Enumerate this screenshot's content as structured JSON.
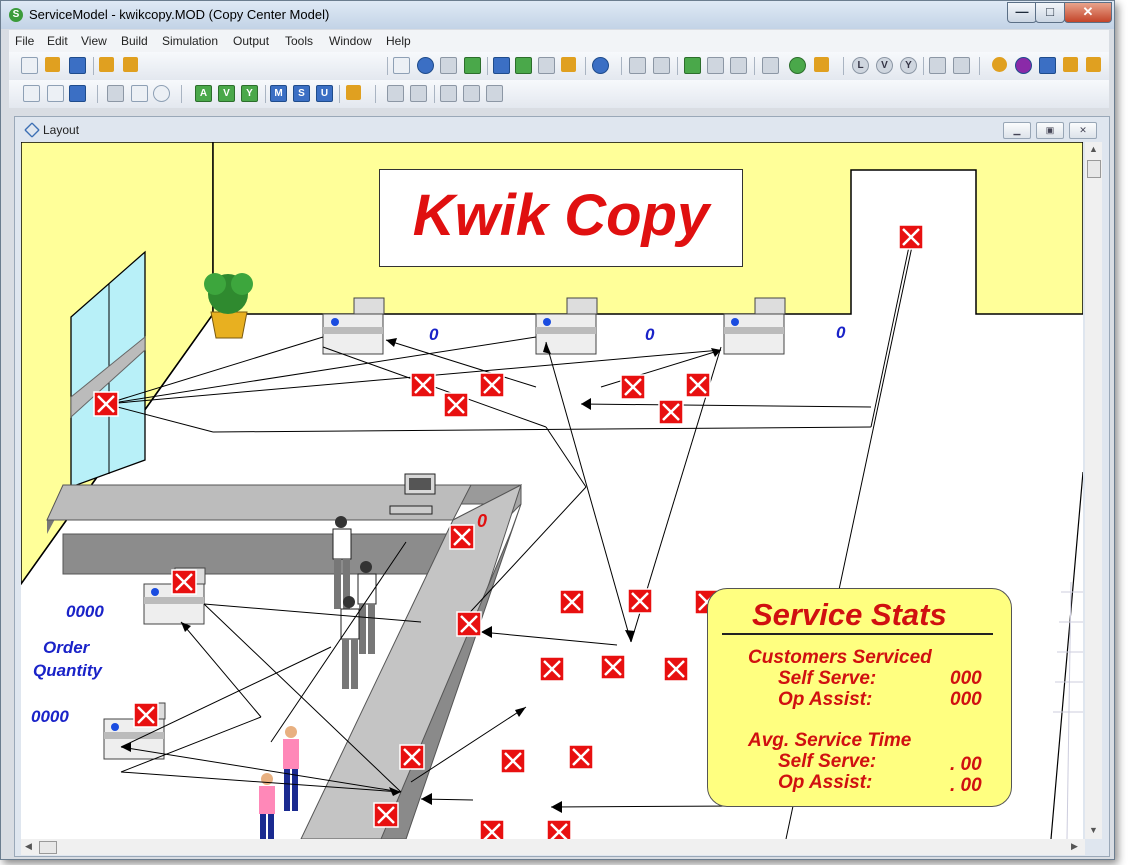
{
  "window": {
    "title": "ServiceModel - kwikcopy.MOD (Copy Center Model)",
    "app_icon": "S",
    "controls": {
      "minimize": "—",
      "maximize": "□",
      "close": "✕"
    }
  },
  "menu": [
    "File",
    "Edit",
    "View",
    "Build",
    "Simulation",
    "Output",
    "Tools",
    "Window",
    "Help"
  ],
  "toolbar_row2_letters": [
    "A",
    "V",
    "Y",
    "M",
    "S",
    "U"
  ],
  "toolbar_row1_letters": [
    "L",
    "V",
    "Y"
  ],
  "child_window": {
    "title": "Layout"
  },
  "layout": {
    "banner": "Kwik Copy",
    "copier_counts": [
      "0",
      "0",
      "0"
    ],
    "desk_count": "0",
    "order_counts": [
      "0000",
      "0000"
    ],
    "order_label_line1": "Order",
    "order_label_line2": "Quantity"
  },
  "stats": {
    "title": "Service Stats",
    "customers_heading": "Customers Serviced",
    "self_serve_label": "Self Serve:",
    "self_serve_value": "000",
    "op_assist_label": "Op Assist:",
    "op_assist_value": "000",
    "avg_heading": "Avg. Service Time",
    "avg_self_label": "Self Serve:",
    "avg_self_value": ". 00",
    "avg_op_label": "Op Assist:",
    "avg_op_value": ". 00"
  },
  "colors": {
    "wall": "#ffff99",
    "accent_red": "#e01010",
    "label_blue": "#1a23c8"
  }
}
